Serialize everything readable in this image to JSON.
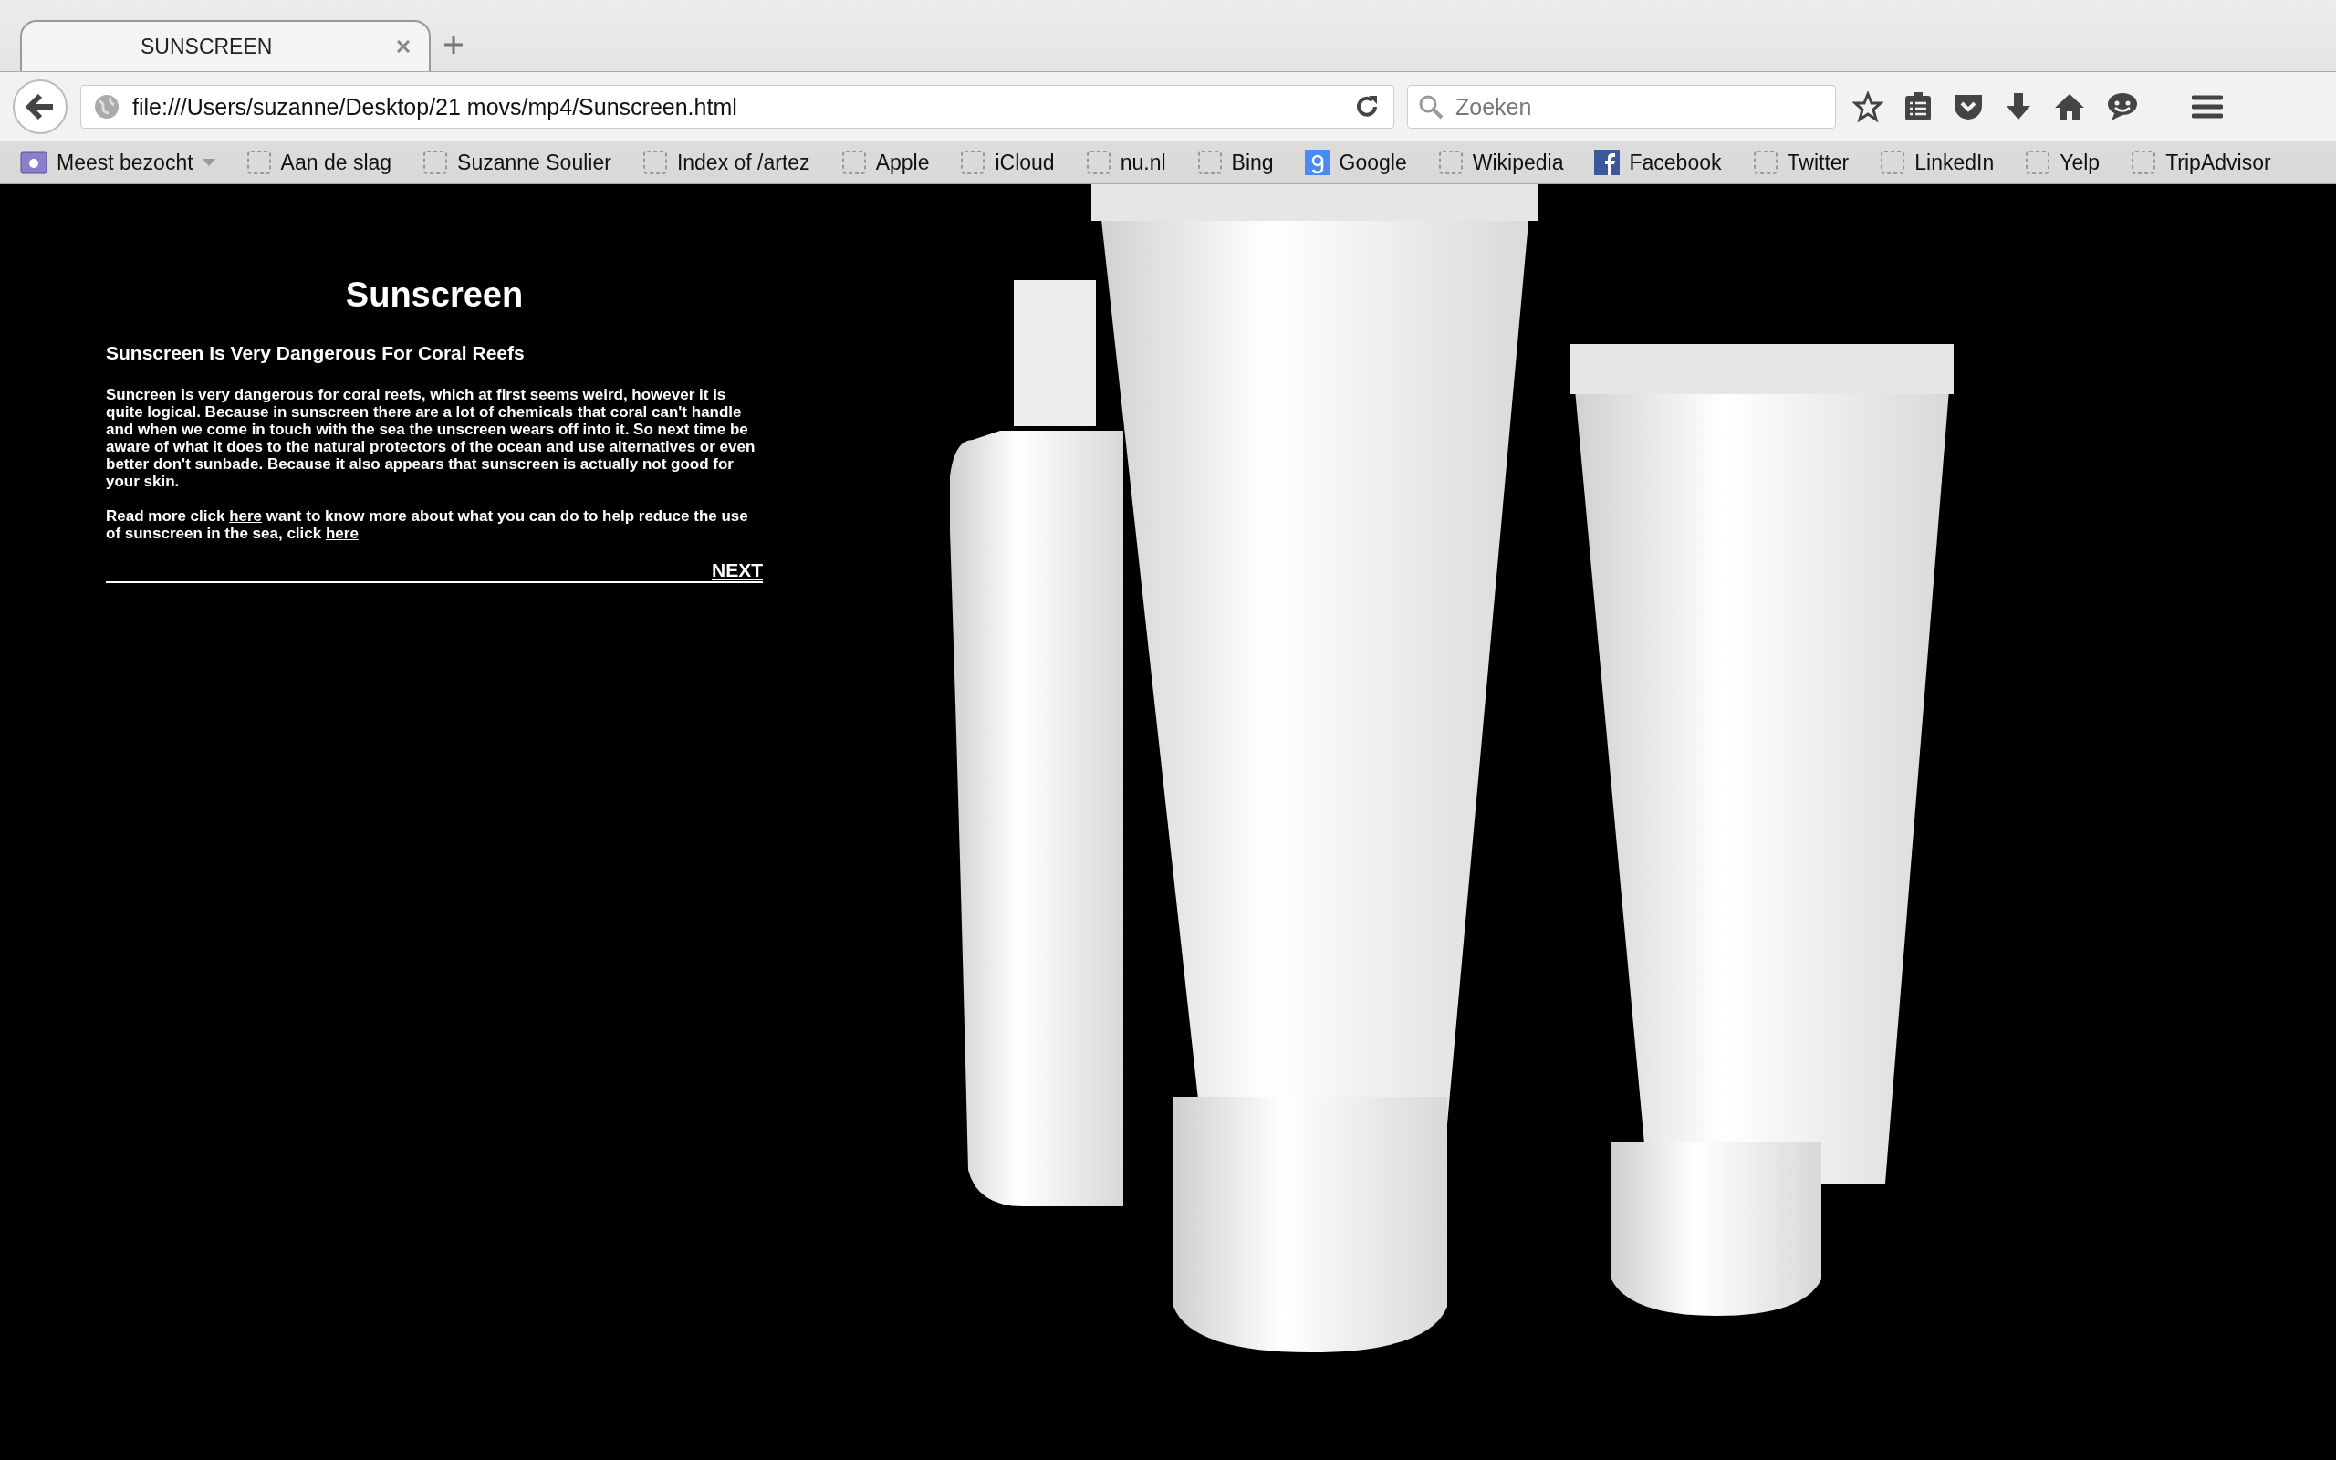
{
  "tabs": [
    {
      "title": "SUNSCREEN",
      "selected": true
    }
  ],
  "toolbar": {
    "url": "file:///Users/suzanne/Desktop/21 movs/mp4/Sunscreen.html",
    "search": {
      "placeholder": "Zoeken"
    }
  },
  "bookmarks": [
    {
      "label": "Meest bezocht",
      "kind": "folder"
    },
    {
      "label": "Aan de slag",
      "kind": "page"
    },
    {
      "label": "Suzanne Soulier",
      "kind": "page"
    },
    {
      "label": "Index of /artez",
      "kind": "page"
    },
    {
      "label": "Apple",
      "kind": "page"
    },
    {
      "label": "iCloud",
      "kind": "page"
    },
    {
      "label": "nu.nl",
      "kind": "page"
    },
    {
      "label": "Bing",
      "kind": "page"
    },
    {
      "label": "Google",
      "kind": "google"
    },
    {
      "label": "Wikipedia",
      "kind": "page"
    },
    {
      "label": "Facebook",
      "kind": "facebook"
    },
    {
      "label": "Twitter",
      "kind": "page"
    },
    {
      "label": "LinkedIn",
      "kind": "page"
    },
    {
      "label": "Yelp",
      "kind": "page"
    },
    {
      "label": "TripAdvisor",
      "kind": "page"
    }
  ],
  "article": {
    "title": "Sunscreen",
    "subtitle": "Sunscreen Is Very Dangerous For Coral Reefs",
    "body": "Suncreen is very dangerous for coral reefs, which at first seems weird, however it is quite logical. Because in sunscreen there are a lot of chemicals that coral can't handle and when we come in touch with the sea the unscreen wears off into it. So next time be aware of what it does to the natural protectors of the ocean and use alternatives or even better don't sunbade. Because it also appears that sunscreen is actually not good for your skin.",
    "read_more": [
      {
        "kind": "text",
        "text": "Read more click "
      },
      {
        "kind": "link",
        "text": "here"
      },
      {
        "kind": "text",
        "text": " want to know more about what you can do to help reduce the use of sunscreen in the sea, click "
      },
      {
        "kind": "link",
        "text": "here"
      }
    ],
    "next": "NEXT"
  }
}
